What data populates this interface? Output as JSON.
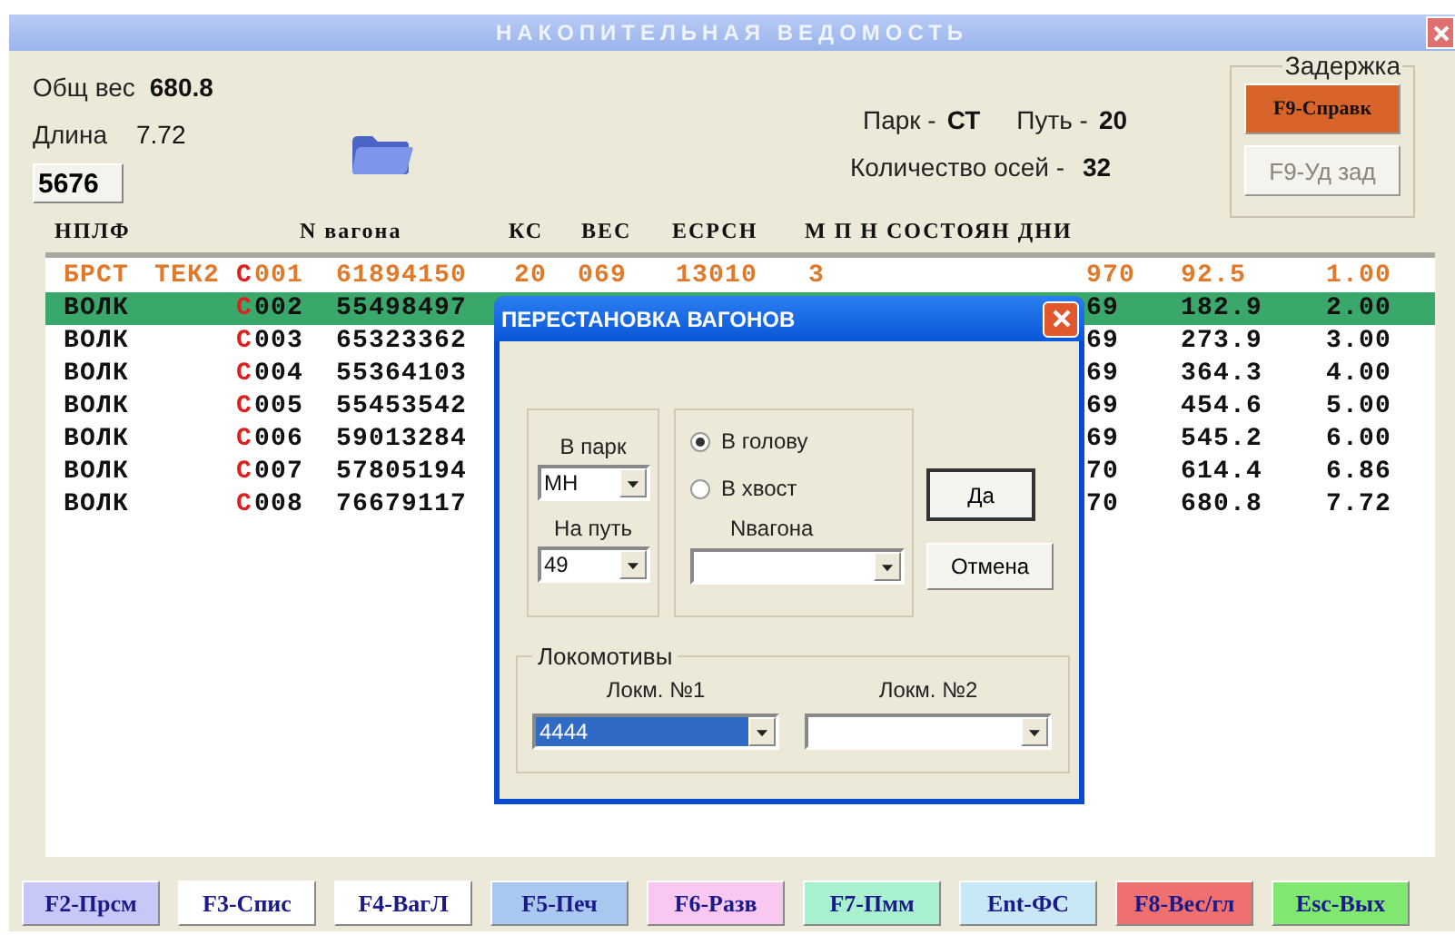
{
  "window": {
    "title": "НАКОПИТЕЛЬНАЯ ВЕДОМОСТЬ"
  },
  "summary": {
    "weight_label": "Общ вес",
    "weight": "680.8",
    "length_label": "Длина",
    "length": "7.72",
    "number_button": "5676",
    "park_label": "Парк -",
    "park": "СТ",
    "track_label": "Путь -",
    "track": "20",
    "axles_label": "Количество осей -",
    "axles": "32"
  },
  "delay": {
    "title": "Задержка",
    "buttons": [
      {
        "label": "F9-Справк",
        "disabled": false
      },
      {
        "label": "F9-Уд зад",
        "disabled": true
      }
    ]
  },
  "table": {
    "columns": [
      "НПЛФ",
      "N вагона",
      "КС",
      "ВЕС",
      "ЕСРСН",
      "М П Н СОСТОЯН ДНИ"
    ],
    "rows": [
      {
        "kind": "head",
        "selected": false,
        "nplf": "БРСТ",
        "type": "ТЕК2",
        "series": "С",
        "index": "001",
        "number": "61894150",
        "ks": "20",
        "ves": "069",
        "esrsn": "13010",
        "m": "3",
        "column_10": "970",
        "column_11": "92.5",
        "column_12": "1.00"
      },
      {
        "kind": "wagon",
        "selected": true,
        "nplf": "ВОЛК",
        "series": "С",
        "index": "002",
        "number": "55498497",
        "column_10": "69",
        "column_11": "182.9",
        "column_12": "2.00"
      },
      {
        "kind": "wagon",
        "selected": false,
        "nplf": "ВОЛК",
        "series": "С",
        "index": "003",
        "number": "65323362",
        "column_10": "69",
        "column_11": "273.9",
        "column_12": "3.00"
      },
      {
        "kind": "wagon",
        "selected": false,
        "nplf": "ВОЛК",
        "series": "С",
        "index": "004",
        "number": "55364103",
        "column_10": "69",
        "column_11": "364.3",
        "column_12": "4.00"
      },
      {
        "kind": "wagon",
        "selected": false,
        "nplf": "ВОЛК",
        "series": "С",
        "index": "005",
        "number": "55453542",
        "column_10": "69",
        "column_11": "454.6",
        "column_12": "5.00"
      },
      {
        "kind": "wagon",
        "selected": false,
        "nplf": "ВОЛК",
        "series": "С",
        "index": "006",
        "number": "59013284",
        "column_10": "69",
        "column_11": "545.2",
        "column_12": "6.00"
      },
      {
        "kind": "wagon",
        "selected": false,
        "nplf": "ВОЛК",
        "series": "С",
        "index": "007",
        "number": "57805194",
        "column_10": "70",
        "column_11": "614.4",
        "column_12": "6.86"
      },
      {
        "kind": "wagon",
        "selected": false,
        "nplf": "ВОЛК",
        "series": "С",
        "index": "008",
        "number": "76679117",
        "column_10": "70",
        "column_11": "680.8",
        "column_12": "7.72"
      }
    ]
  },
  "dialog": {
    "title": "ПЕРЕСТАНОВКА ВАГОНОВ",
    "park_label": "В парк",
    "park": "МН",
    "track_label": "На путь",
    "track": "49",
    "positions": [
      {
        "label": "В голову",
        "selected": true
      },
      {
        "label": "В хвост",
        "selected": false
      }
    ],
    "wagon_label": "Nвагона",
    "ok": "Да",
    "cancel": "Отмена",
    "locomotives": {
      "title": "Локомотивы",
      "fields": [
        {
          "label": "Локм. №1",
          "value": "4444",
          "selected": true
        },
        {
          "label": "Локм. №2",
          "selected": false
        }
      ]
    }
  },
  "function_keys": [
    {
      "label": "F2-Прсм",
      "color": "#c8c8f8"
    },
    {
      "label": "F3-Спис",
      "color": "#ffffff"
    },
    {
      "label": "F4-ВагЛ",
      "color": "#ffffff"
    },
    {
      "label": "F5-Печ",
      "color": "#a8c8f0"
    },
    {
      "label": "F6-Разв",
      "color": "#f8c8f0"
    },
    {
      "label": "F7-Пмм",
      "color": "#a8f0d0"
    },
    {
      "label": "Ent-ФС",
      "color": "#c8e8f8"
    },
    {
      "label": "F8-Вес/гл",
      "color": "#f07070"
    },
    {
      "label": "Esc-Вых",
      "color": "#80e870"
    }
  ]
}
